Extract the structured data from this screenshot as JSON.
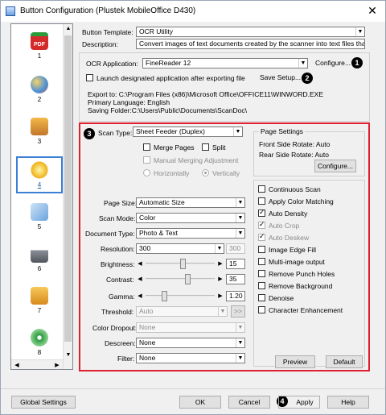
{
  "window": {
    "title": "Button Configuration (Plustek MobileOffice D430)",
    "close": "✕"
  },
  "sidebar": {
    "items": [
      {
        "num": "1",
        "icon": "pdf-icon"
      },
      {
        "num": "2",
        "icon": "palette-icon"
      },
      {
        "num": "3",
        "icon": "printer-photo-icon"
      },
      {
        "num": "4",
        "icon": "ocr-sun-icon"
      },
      {
        "num": "5",
        "icon": "share-icon"
      },
      {
        "num": "6",
        "icon": "printer-icon"
      },
      {
        "num": "7",
        "icon": "ftp-icon"
      },
      {
        "num": "8",
        "icon": "disc-icon"
      }
    ]
  },
  "template": {
    "label": "Button Template:",
    "value": "OCR Utility"
  },
  "description": {
    "label": "Description:",
    "value": "Convert images of text documents created by the scanner into text files that can b"
  },
  "ocr": {
    "label": "OCR Application:",
    "value": "FineReader 12",
    "configure": "Configure...",
    "launch_label": "Launch designated application after exporting file",
    "save_setup": "Save Setup...",
    "export_line": "Export to: C:\\Program Files (x86)\\Microsoft Office\\OFFICE11\\WINWORD.EXE",
    "language_line": "Primary Language: English",
    "folder_line": "Saving Folder:C:\\Users\\Public\\Documents\\ScanDoc\\"
  },
  "badges": {
    "b1": "1",
    "b2": "2",
    "b3": "3",
    "b4": "4"
  },
  "scan": {
    "scan_type_label": "Scan Type:",
    "scan_type_value": "Sheet Feeder (Duplex)",
    "merge_pages": "Merge Pages",
    "split": "Split",
    "manual_merging": "Manual Merging Adjustment",
    "horizontally": "Horizontally",
    "vertically": "Vertically",
    "page_settings_title": "Page Settings",
    "front_rotate": "Front Side Rotate: Auto",
    "rear_rotate": "Rear Side Rotate: Auto",
    "configure": "Configure...",
    "page_size_label": "Page Size:",
    "page_size_value": "Automatic Size",
    "scan_mode_label": "Scan Mode:",
    "scan_mode_value": "Color",
    "doc_type_label": "Document Type:",
    "doc_type_value": "Photo & Text",
    "resolution_label": "Resolution:",
    "resolution_value": "300",
    "resolution_alt": "300",
    "brightness_label": "Brightness:",
    "brightness_value": "15",
    "brightness_level": 0.55,
    "contrast_label": "Contrast:",
    "contrast_value": "35",
    "contrast_level": 0.62,
    "gamma_label": "Gamma:",
    "gamma_value": "1.20",
    "gamma_level": 0.25,
    "threshold_label": "Threshold:",
    "threshold_value": "Auto",
    "threshold_btn": ">>",
    "color_dropout_label": "Color Dropout:",
    "color_dropout_value": "None",
    "descreen_label": "Descreen:",
    "descreen_value": "None",
    "filter_label": "Filter:",
    "filter_value": "None",
    "options": [
      {
        "label": "Continuous Scan",
        "checked": false,
        "disabled": false
      },
      {
        "label": "Apply Color Matching",
        "checked": false,
        "disabled": false
      },
      {
        "label": "Auto Density",
        "checked": true,
        "disabled": false
      },
      {
        "label": "Auto Crop",
        "checked": true,
        "disabled": true
      },
      {
        "label": "Auto Deskew",
        "checked": true,
        "disabled": true
      },
      {
        "label": "Image Edge Fill",
        "checked": false,
        "disabled": false
      },
      {
        "label": "Multi-image output",
        "checked": false,
        "disabled": false
      },
      {
        "label": "Remove Punch Holes",
        "checked": false,
        "disabled": false
      },
      {
        "label": "Remove Background",
        "checked": false,
        "disabled": false
      },
      {
        "label": "Denoise",
        "checked": false,
        "disabled": false
      },
      {
        "label": "Character Enhancement",
        "checked": false,
        "disabled": false
      }
    ],
    "preview": "Preview",
    "default": "Default"
  },
  "footer": {
    "global_settings": "Global Settings",
    "ok": "OK",
    "cancel": "Cancel",
    "apply": "Apply",
    "help": "Help"
  }
}
